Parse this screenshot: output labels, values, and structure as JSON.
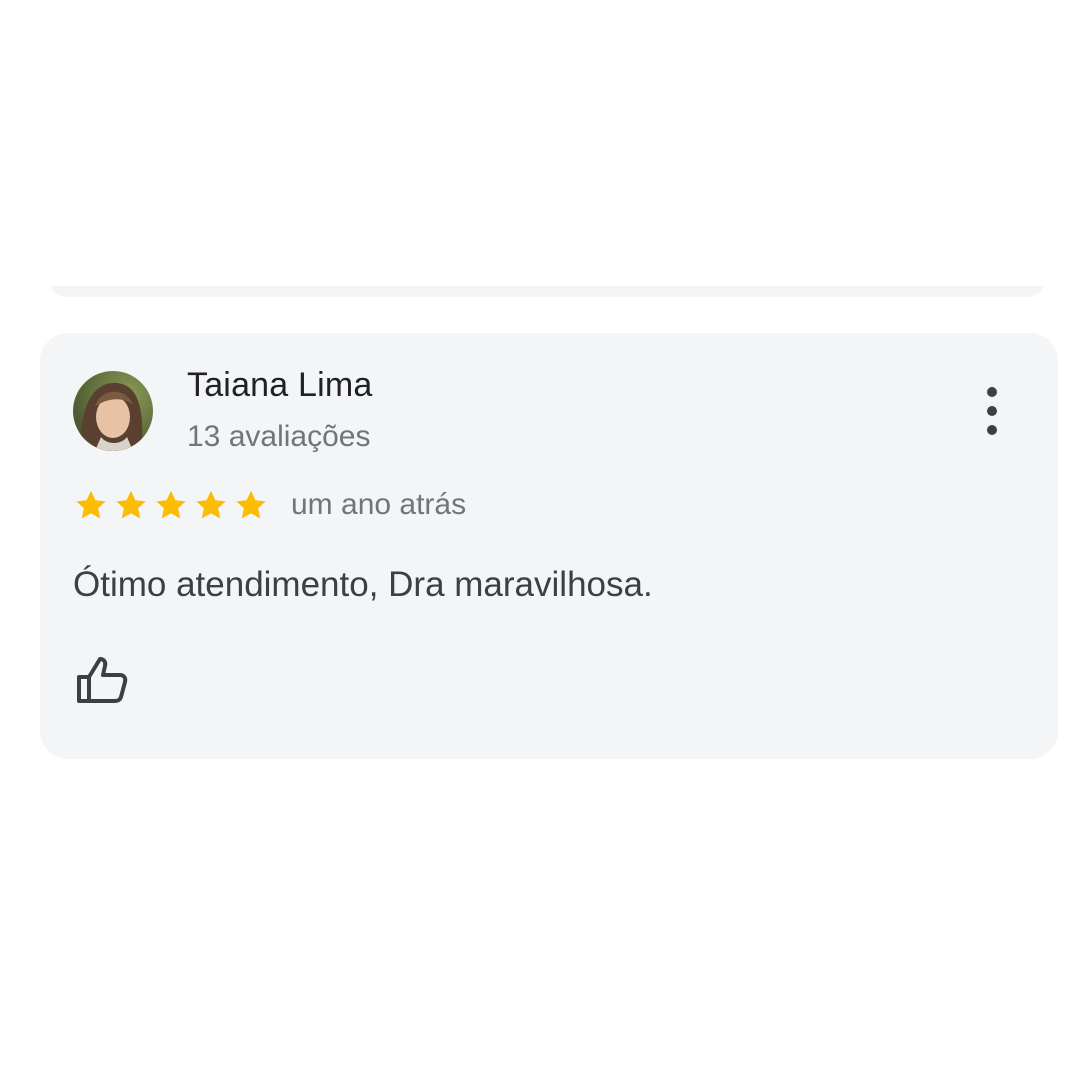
{
  "review": {
    "reviewer_name": "Taiana Lima",
    "review_count": "13 avaliações",
    "rating": 5,
    "rating_max": 5,
    "date": "um ano atrás",
    "text": "Ótimo atendimento, Dra maravilhosa."
  },
  "icons": {
    "star": "star-icon",
    "more": "more-vert-icon",
    "like": "thumb-up-icon"
  },
  "colors": {
    "card_background": "#f4f5f7",
    "star": "#fbbc04",
    "name_text": "#202124",
    "secondary_text": "#70757a",
    "body_text": "#3c4043"
  }
}
